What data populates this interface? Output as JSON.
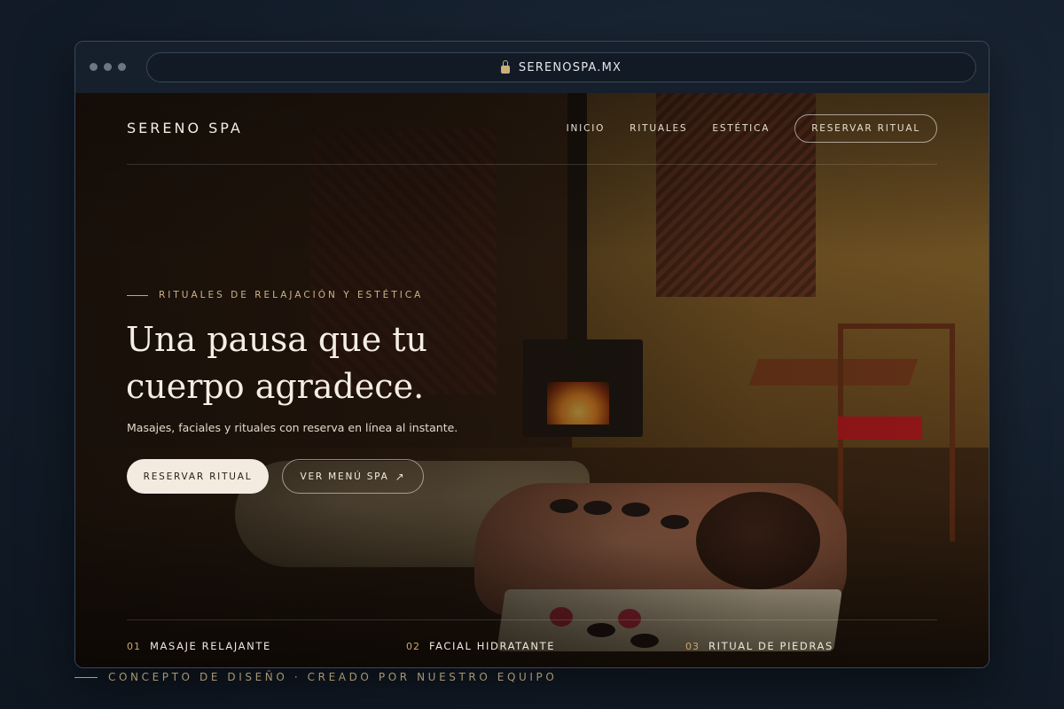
{
  "browser": {
    "url": "SERENOSPA.MX"
  },
  "nav": {
    "logo": "SERENO SPA",
    "items": [
      "INICIO",
      "RITUALES",
      "ESTÉTICA"
    ],
    "cta": "RESERVAR RITUAL"
  },
  "hero": {
    "eyebrow": "RITUALES DE RELAJACIÓN Y ESTÉTICA",
    "headline": "Una pausa que tu cuerpo agradece.",
    "subtitle": "Masajes, faciales y rituales con reserva en línea al instante.",
    "primary_button": "RESERVAR RITUAL",
    "secondary_button": "VER MENÚ SPA"
  },
  "services": [
    {
      "num": "01",
      "label": "MASAJE RELAJANTE"
    },
    {
      "num": "02",
      "label": "FACIAL HIDRATANTE"
    },
    {
      "num": "03",
      "label": "RITUAL DE PIEDRAS"
    }
  ],
  "caption": "CONCEPTO DE DISEÑO · CREADO POR NUESTRO EQUIPO",
  "colors": {
    "accent": "#c9a86a",
    "cream": "#f3ebdf",
    "background": "#131d2a"
  },
  "icons": {
    "lock": "lock-icon",
    "arrow": "arrow-up-right-icon"
  }
}
